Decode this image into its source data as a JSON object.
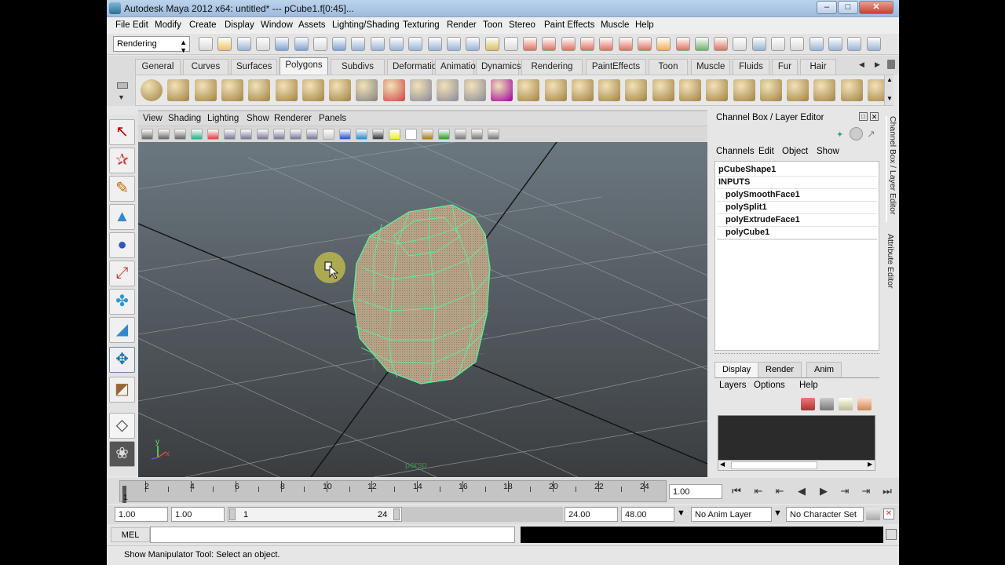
{
  "window": {
    "title": "Autodesk Maya 2012 x64: untitled*   ---   pCube1.f[0:45]...",
    "controls": [
      "minimize",
      "maximize",
      "close"
    ]
  },
  "menubar": [
    "File",
    "Edit",
    "Modify",
    "Create",
    "Display",
    "Window",
    "Assets",
    "Lighting/Shading",
    "Texturing",
    "Render",
    "Toon",
    "Stereo",
    "Paint Effects",
    "Muscle",
    "Help"
  ],
  "status_line": {
    "menu_set": "Rendering"
  },
  "shelf": {
    "tabs": [
      "General",
      "Curves",
      "Surfaces",
      "Polygons",
      "Subdivs",
      "Deformation",
      "Animation",
      "Dynamics",
      "Rendering",
      "PaintEffects",
      "Toon",
      "Muscle",
      "Fluids",
      "Fur",
      "Hair"
    ],
    "active_tab": "Polygons"
  },
  "toolbox": {
    "tools": [
      "select-tool",
      "lasso-tool",
      "paint-select-tool",
      "move-tool",
      "rotate-tool",
      "scale-tool",
      "universal-manipulator",
      "soft-modification-tool",
      "show-manipulator-tool",
      "last-tool-used",
      "quad-layout",
      "single-perspective"
    ]
  },
  "viewport": {
    "menu": [
      "View",
      "Shading",
      "Lighting",
      "Show",
      "Renderer",
      "Panels"
    ],
    "camera_label": "persp",
    "axis_y": "y",
    "axis_x": "x"
  },
  "channel_box": {
    "title": "Channel Box / Layer Editor",
    "menu": [
      "Channels",
      "Edit",
      "Object",
      "Show"
    ],
    "shape_node": "pCubeShape1",
    "inputs_header": "INPUTS",
    "inputs": [
      "polySmoothFace1",
      "polySplit1",
      "polyExtrudeFace1",
      "polyCube1"
    ]
  },
  "layer_editor": {
    "tabs": [
      "Display",
      "Render",
      "Anim"
    ],
    "active_tab": "Display",
    "menu": [
      "Layers",
      "Options",
      "Help"
    ]
  },
  "side_tabs": [
    "Channel Box / Layer Editor",
    "Attribute Editor"
  ],
  "time_slider": {
    "ticks": [
      "2",
      "4",
      "6",
      "8",
      "10",
      "12",
      "14",
      "16",
      "18",
      "20",
      "22",
      "24"
    ],
    "start_label": "1",
    "current_time": "1.00",
    "playback_buttons": [
      "go-to-start",
      "step-back-key",
      "step-back-frame",
      "play-backward",
      "play-forward",
      "step-forward-frame",
      "step-forward-key",
      "go-to-end"
    ]
  },
  "range_slider": {
    "anim_start": "1.00",
    "playback_start": "1.00",
    "range_start": "1",
    "range_end": "24",
    "playback_end": "24.00",
    "anim_end": "48.00",
    "anim_layer": "No Anim Layer",
    "character_set": "No Character Set"
  },
  "command_line": {
    "label": "MEL",
    "value": ""
  },
  "help_line": {
    "text": "Show Manipulator Tool: Select an object."
  },
  "colors": {
    "wireframe": "#5cf09a",
    "mesh": "#b6a085",
    "viewport_top": "#6d7880",
    "viewport_bottom": "#3a3d40",
    "titlebar": "#a9c3e2"
  }
}
